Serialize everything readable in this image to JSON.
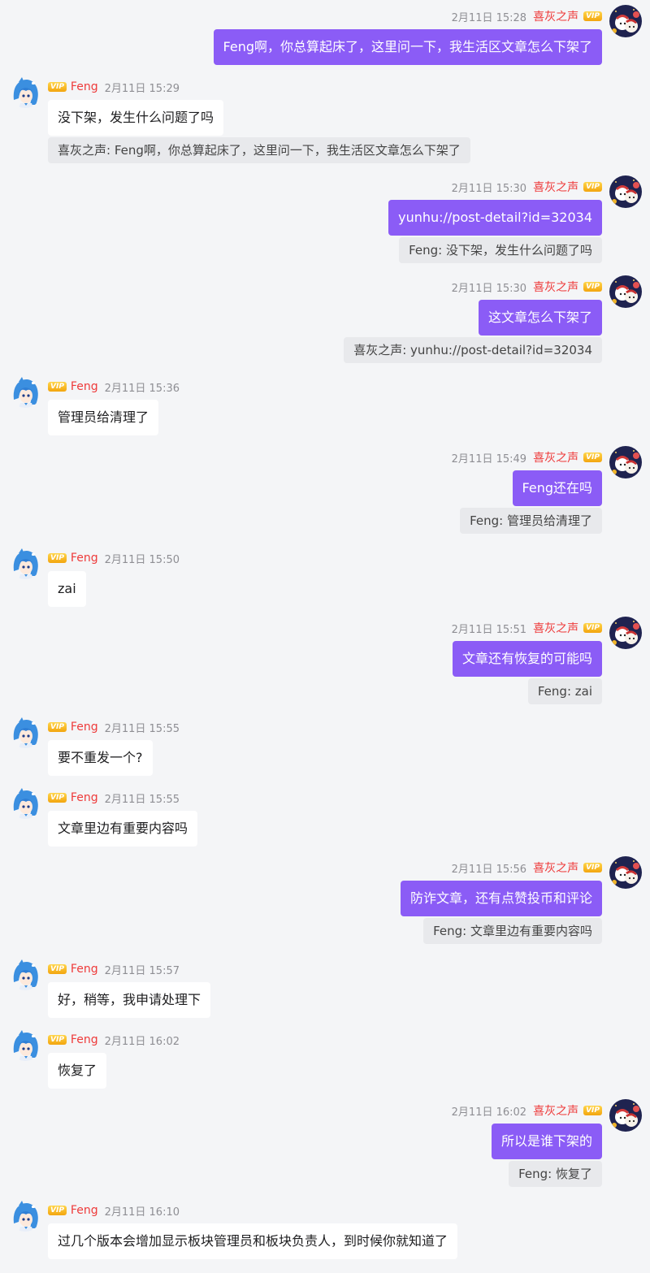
{
  "vip_label": "VIP",
  "messages": [
    {
      "side": "right",
      "name": "喜灰之声",
      "time": "2月11日 15:28",
      "text": "Feng啊，你总算起床了，这里问一下，我生活区文章怎么下架了",
      "quote": null
    },
    {
      "side": "left",
      "name": "Feng",
      "time": "2月11日 15:29",
      "text": "没下架，发生什么问题了吗",
      "quote": "喜灰之声: Feng啊，你总算起床了，这里问一下，我生活区文章怎么下架了"
    },
    {
      "side": "right",
      "name": "喜灰之声",
      "time": "2月11日 15:30",
      "text": "yunhu://post-detail?id=32034",
      "quote": "Feng: 没下架，发生什么问题了吗"
    },
    {
      "side": "right",
      "name": "喜灰之声",
      "time": "2月11日 15:30",
      "text": "这文章怎么下架了",
      "quote": "喜灰之声: yunhu://post-detail?id=32034"
    },
    {
      "side": "left",
      "name": "Feng",
      "time": "2月11日 15:36",
      "text": "管理员给清理了",
      "quote": null
    },
    {
      "side": "right",
      "name": "喜灰之声",
      "time": "2月11日 15:49",
      "text": "Feng还在吗",
      "quote": "Feng: 管理员给清理了"
    },
    {
      "side": "left",
      "name": "Feng",
      "time": "2月11日 15:50",
      "text": "zai",
      "quote": null
    },
    {
      "side": "right",
      "name": "喜灰之声",
      "time": "2月11日 15:51",
      "text": "文章还有恢复的可能吗",
      "quote": "Feng: zai"
    },
    {
      "side": "left",
      "name": "Feng",
      "time": "2月11日 15:55",
      "text": "要不重发一个?",
      "quote": null
    },
    {
      "side": "left",
      "name": "Feng",
      "time": "2月11日 15:55",
      "text": "文章里边有重要内容吗",
      "quote": null
    },
    {
      "side": "right",
      "name": "喜灰之声",
      "time": "2月11日 15:56",
      "text": "防诈文章，还有点赞投币和评论",
      "quote": "Feng: 文章里边有重要内容吗"
    },
    {
      "side": "left",
      "name": "Feng",
      "time": "2月11日 15:57",
      "text": "好，稍等，我申请处理下",
      "quote": null
    },
    {
      "side": "left",
      "name": "Feng",
      "time": "2月11日 16:02",
      "text": "恢复了",
      "quote": null
    },
    {
      "side": "right",
      "name": "喜灰之声",
      "time": "2月11日 16:02",
      "text": "所以是谁下架的",
      "quote": "Feng: 恢复了"
    },
    {
      "side": "left",
      "name": "Feng",
      "time": "2月11日 16:10",
      "text": "过几个版本会增加显示板块管理员和板块负责人，到时候你就知道了",
      "quote": null
    }
  ]
}
